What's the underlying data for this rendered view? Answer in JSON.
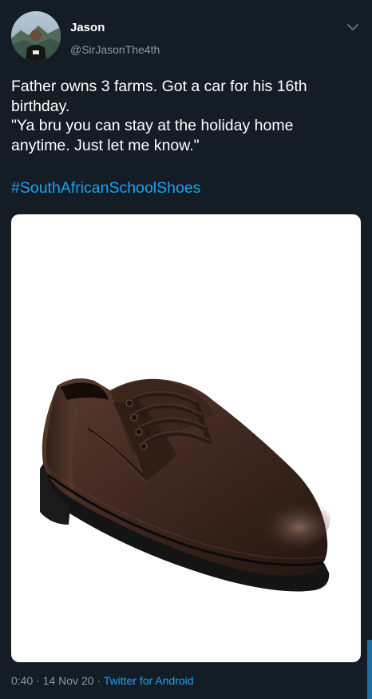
{
  "author": {
    "name": "Jason",
    "handle": "@SirJasonThe4th",
    "avatar_icon": "profile-photo-mountain"
  },
  "menu_icon": "chevron-down-icon",
  "tweet": {
    "text_lines": [
      "Father owns 3 farms. Got a car for his 16th",
      "birthday.",
      "\"Ya bru you can stay at the holiday home",
      "anytime. Just let me know.\""
    ],
    "hashtag": "#SouthAfricanSchoolShoes"
  },
  "media": {
    "description_icon": "brown-school-shoe-image"
  },
  "meta": {
    "time": "0:40",
    "separator": " · ",
    "date": "14 Nov 20",
    "source": "Twitter for Android"
  },
  "colors": {
    "background": "#141d26",
    "text_primary": "#ffffff",
    "text_secondary": "#8899a6",
    "link": "#1da1f2"
  }
}
